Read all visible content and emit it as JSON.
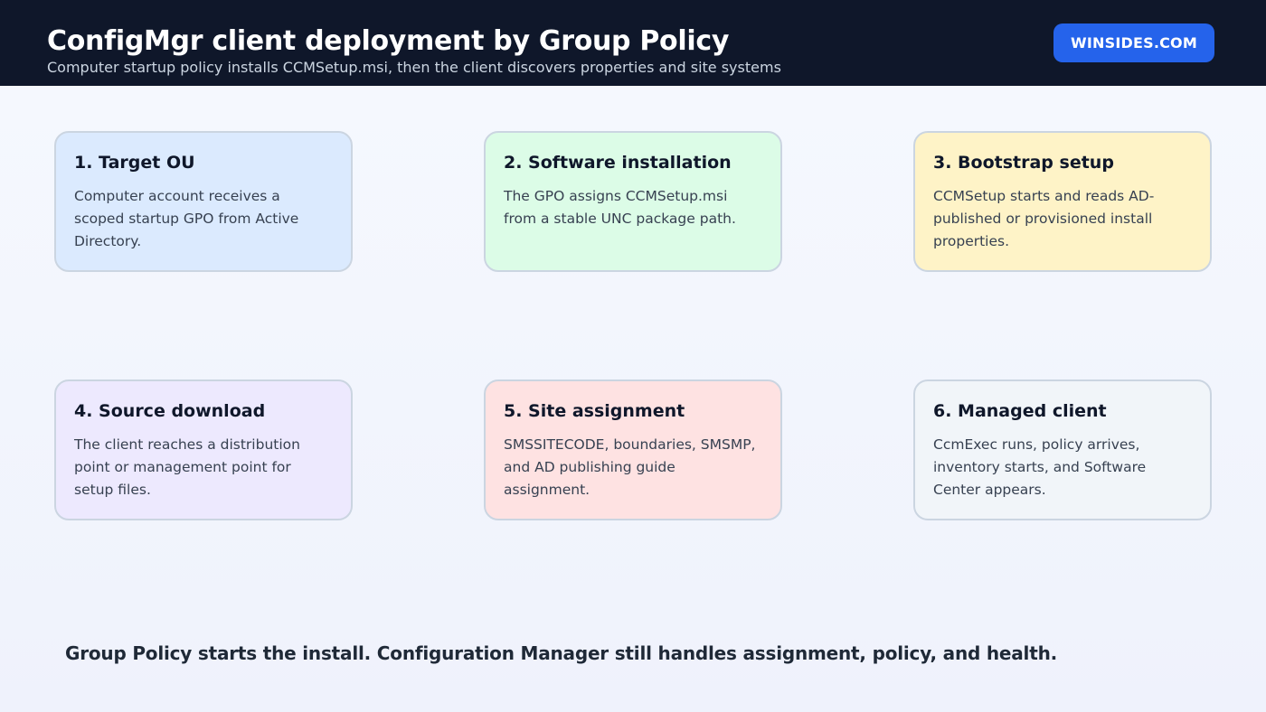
{
  "header": {
    "title": "ConfigMgr client deployment by Group Policy",
    "subtitle": "Computer startup policy installs CCMSetup.msi, then the client discovers properties and site systems",
    "brand": "WINSIDES.COM"
  },
  "steps": [
    {
      "title": "1. Target OU",
      "body": "Computer account receives a scoped startup GPO from Active Directory."
    },
    {
      "title": "2. Software installation",
      "body": "The GPO assigns CCMSetup.msi from a stable UNC package path."
    },
    {
      "title": "3. Bootstrap setup",
      "body": "CCMSetup starts and reads AD-published or provisioned install properties."
    },
    {
      "title": "4. Source download",
      "body": "The client reaches a distribution point or management point for setup files."
    },
    {
      "title": "5. Site assignment",
      "body": "SMSSITECODE, boundaries, SMSMP, and AD publishing guide assignment."
    },
    {
      "title": "6. Managed client",
      "body": "CcmExec runs, policy arrives, inventory starts, and Software Center appears."
    }
  ],
  "footer": "Group Policy starts the install. Configuration Manager still handles assignment, policy, and health."
}
